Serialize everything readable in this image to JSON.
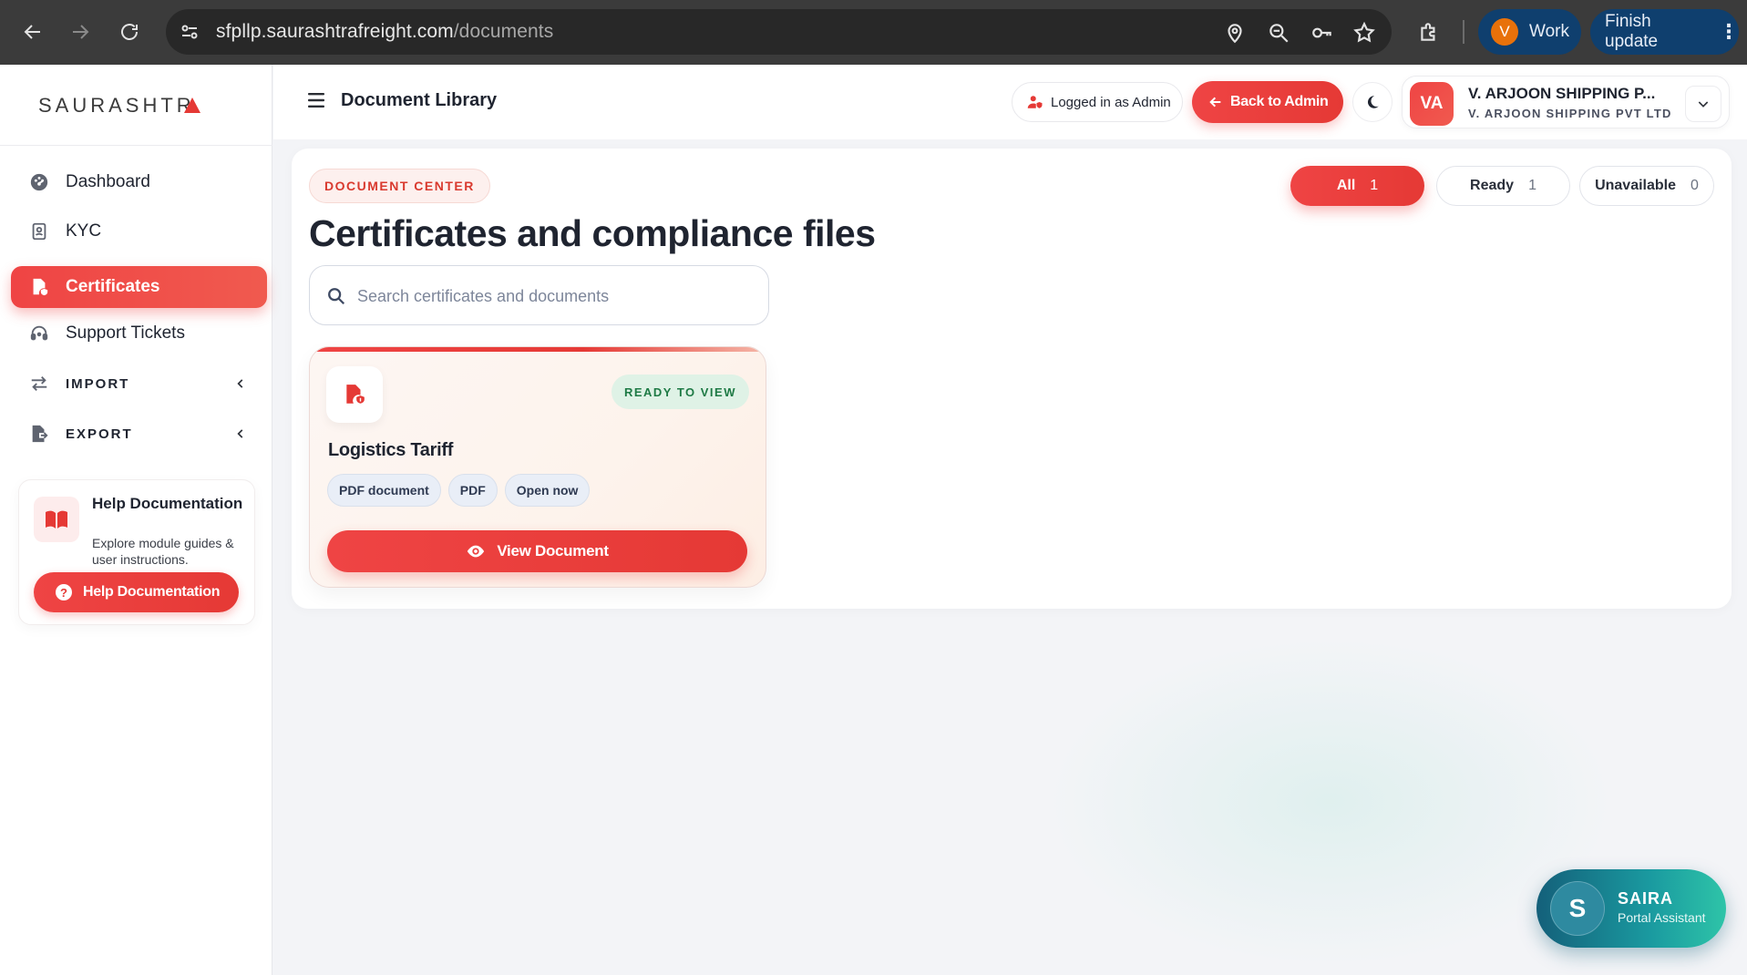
{
  "browser": {
    "url_host": "sfpllp.saurashtrafreight.com",
    "url_path": "/documents",
    "profile_initial": "V",
    "profile_label": "Work",
    "update_label": "Finish update"
  },
  "sidebar": {
    "brand": "SAURASHTR",
    "items": [
      {
        "label": "Dashboard",
        "icon": "dashboard-icon"
      },
      {
        "label": "KYC",
        "icon": "id-card-icon"
      },
      {
        "label": "Certificates",
        "icon": "certificate-file-icon",
        "active": true
      },
      {
        "label": "Support Tickets",
        "icon": "headset-icon"
      },
      {
        "label": "IMPORT",
        "icon": "import-arrows-icon"
      },
      {
        "label": "EXPORT",
        "icon": "export-file-icon"
      }
    ],
    "help": {
      "title": "Help Documentation",
      "description": "Explore module guides & user instructions.",
      "button": "Help Documentation"
    }
  },
  "topbar": {
    "title": "Document Library",
    "logged_in": "Logged in as Admin",
    "back": "Back to Admin",
    "account": {
      "initials": "VA",
      "name": "V. ARJOON SHIPPING P...",
      "sub": "V. ARJOON SHIPPING PVT LTD"
    }
  },
  "main": {
    "badge": "DOCUMENT CENTER",
    "heading": "Certificates and compliance files",
    "search_placeholder": "Search certificates and documents",
    "filters": [
      {
        "label": "All",
        "count": "1",
        "active": true
      },
      {
        "label": "Ready",
        "count": "1"
      },
      {
        "label": "Unavailable",
        "count": "0"
      }
    ],
    "document": {
      "status": "READY TO VIEW",
      "title": "Logistics Tariff",
      "tags": [
        "PDF document",
        "PDF",
        "Open now"
      ],
      "action": "View Document"
    }
  },
  "assistant": {
    "initial": "S",
    "name": "SAIRA",
    "subtitle": "Portal Assistant"
  },
  "colors": {
    "accent": "#ef4444",
    "ready_green": "#1e7a45",
    "assistant_teal": "#1a9aa0",
    "chrome_dark": "#3b3b3b"
  }
}
